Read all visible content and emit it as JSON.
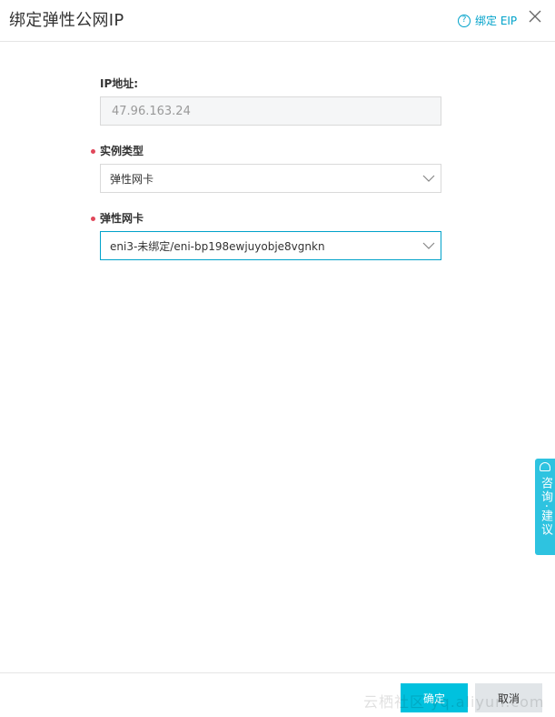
{
  "dialog": {
    "title": "绑定弹性公网IP",
    "help_label": "绑定 EIP",
    "help_icon_glyph": "?"
  },
  "form": {
    "ip": {
      "label": "IP地址:",
      "value": "47.96.163.24"
    },
    "instance_type": {
      "label": "实例类型",
      "required": true,
      "value": "弹性网卡"
    },
    "eni": {
      "label": "弹性网卡",
      "required": true,
      "value": "eni3-未绑定/eni-bp198ewjuyobje8vgnkn"
    }
  },
  "side_widget": {
    "label": "咨询·建议"
  },
  "footer": {
    "ok_label": "确定",
    "cancel_label": "取消"
  },
  "watermark": "云栖社区 yq.aliyun.com",
  "colors": {
    "accent": "#00c1de",
    "link": "#00a2ca",
    "required_dot": "#e0475a"
  }
}
